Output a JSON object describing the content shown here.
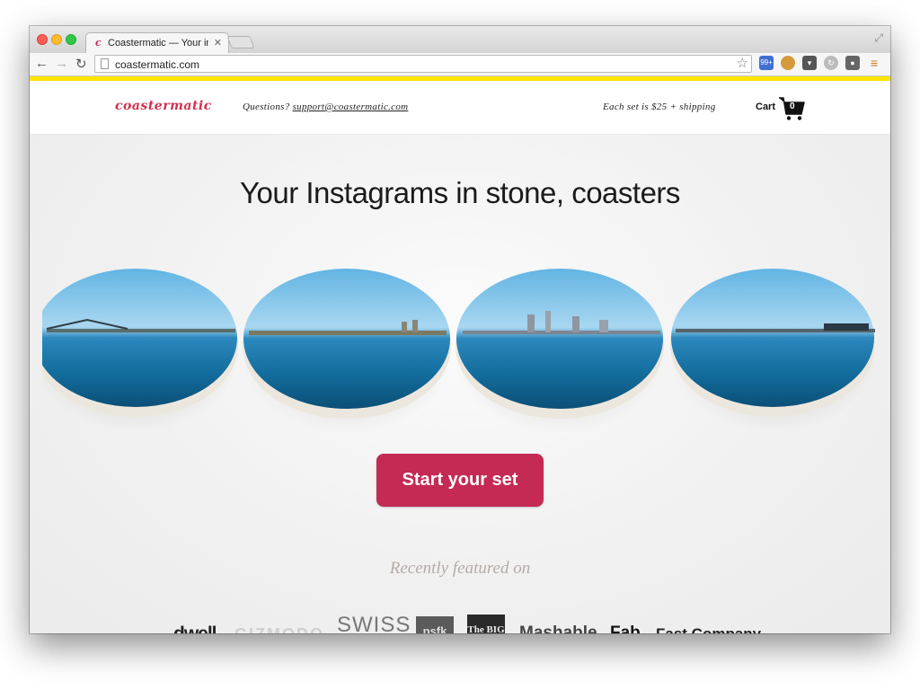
{
  "browser": {
    "tab_title": "Coastermatic — Your insta",
    "tab_close": "✕",
    "url": "coastermatic.com",
    "badge_count": "99+"
  },
  "header": {
    "logo": "coastermatic",
    "questions_label": "Questions?",
    "support_email": "support@coastermatic.com",
    "price_text": "Each set is $25 + shipping",
    "cart_label": "Cart",
    "cart_count": "0"
  },
  "hero": {
    "headline": "Your Instagrams in stone, coasters",
    "cta_label": "Start your set",
    "featured_label": "Recently featured on"
  },
  "press_logos": [
    "dwell",
    "GIZMODO",
    "SWISS",
    "psfk",
    "The BIG",
    "Mashable",
    "Fab",
    "Fast Company"
  ],
  "colors": {
    "brand": "#d0304f",
    "cta": "#c42a53",
    "accent_bar": "#ffe400"
  }
}
